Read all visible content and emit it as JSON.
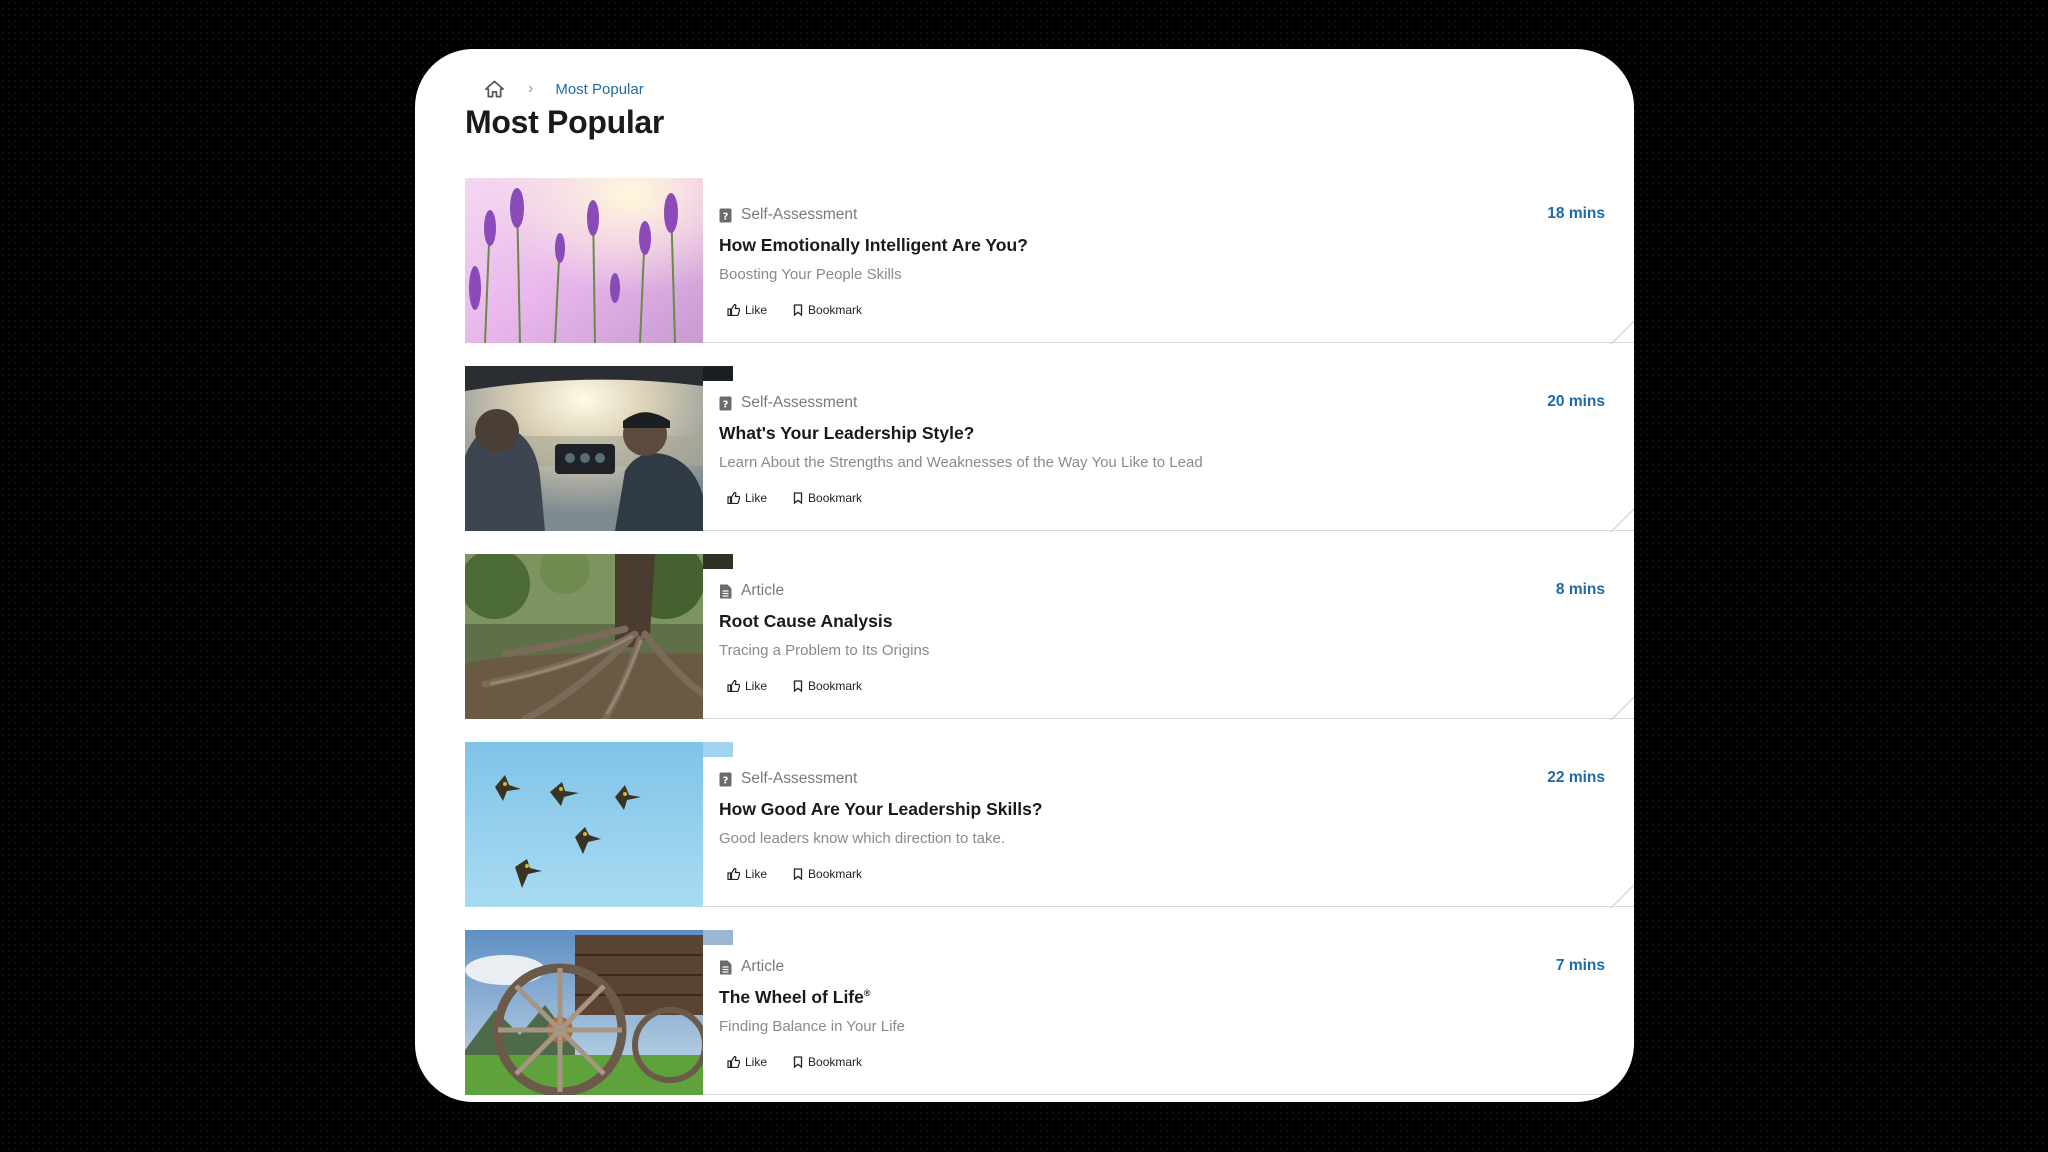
{
  "breadcrumb": {
    "home_icon": "home-icon",
    "separator": "›",
    "current": "Most Popular"
  },
  "page": {
    "title": "Most Popular"
  },
  "cards": [
    {
      "type": "Self-Assessment",
      "type_icon": "question-square-icon",
      "title": "How Emotionally Intelligent Are You?",
      "subtitle": "Boosting Your People Skills",
      "duration": "18 mins",
      "like": "Like",
      "bookmark": "Bookmark",
      "image": "lavender-field"
    },
    {
      "type": "Self-Assessment",
      "type_icon": "question-square-icon",
      "title": "What's Your Leadership Style?",
      "subtitle": "Learn About the Strengths and Weaknesses of the Way You Like to Lead",
      "duration": "20 mins",
      "like": "Like",
      "bookmark": "Bookmark",
      "image": "helicopter-cockpit"
    },
    {
      "type": "Article",
      "type_icon": "document-icon",
      "title": "Root Cause Analysis",
      "subtitle": "Tracing a Problem to Its Origins",
      "duration": "8 mins",
      "like": "Like",
      "bookmark": "Bookmark",
      "image": "tree-roots"
    },
    {
      "type": "Self-Assessment",
      "type_icon": "question-square-icon",
      "title": "How Good Are Your Leadership Skills?",
      "subtitle": "Good leaders know which direction to take.",
      "duration": "22 mins",
      "like": "Like",
      "bookmark": "Bookmark",
      "image": "birds-in-sky"
    },
    {
      "type": "Article",
      "type_icon": "document-icon",
      "title": "The Wheel of Life",
      "title_mark": "®",
      "subtitle": "Finding Balance in Your Life",
      "duration": "7 mins",
      "like": "Like",
      "bookmark": "Bookmark",
      "image": "wagon-wheel"
    }
  ],
  "colors": {
    "accent": "#1f6aa5",
    "text": "#1a1a1a",
    "muted": "#8a8a8a",
    "border": "#d8d8d8"
  }
}
